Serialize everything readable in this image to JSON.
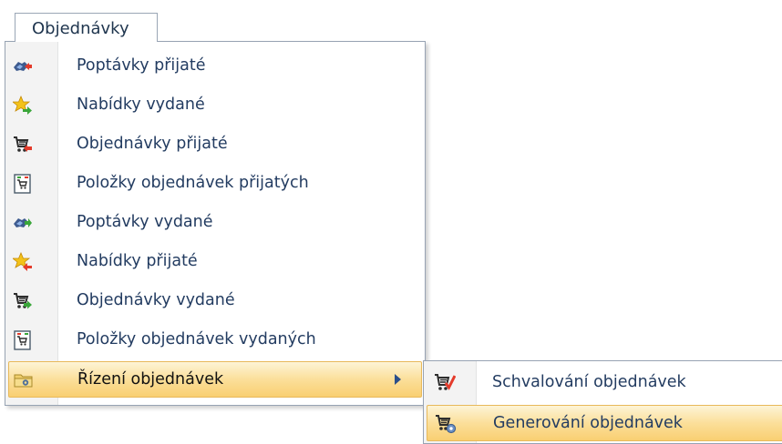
{
  "menu": {
    "title": "Objednávky"
  },
  "items": [
    {
      "label": "Poptávky přijaté",
      "icon": "handshake-in-icon"
    },
    {
      "label": "Nabídky vydané",
      "icon": "star-out-icon"
    },
    {
      "label": "Objednávky přijaté",
      "icon": "cart-in-icon"
    },
    {
      "label": "Položky objednávek přijatých",
      "icon": "document-cart-icon"
    },
    {
      "label": "Poptávky vydané",
      "icon": "handshake-out-icon"
    },
    {
      "label": "Nabídky přijaté",
      "icon": "star-in-icon"
    },
    {
      "label": "Objednávky vydané",
      "icon": "cart-out-icon"
    },
    {
      "label": "Položky objednávek vydaných",
      "icon": "document-cart-icon"
    },
    {
      "label": "Řízení objednávek",
      "icon": "folder-icon",
      "has_submenu": true,
      "highlighted": true
    }
  ],
  "submenu": {
    "items": [
      {
        "label": "Schvalování objednávek",
        "icon": "cart-check-icon"
      },
      {
        "label": "Generování objednávek",
        "icon": "cart-gear-icon",
        "highlighted": true
      }
    ]
  },
  "colors": {
    "highlight": "#fbdf9a",
    "text": "#233c61"
  }
}
